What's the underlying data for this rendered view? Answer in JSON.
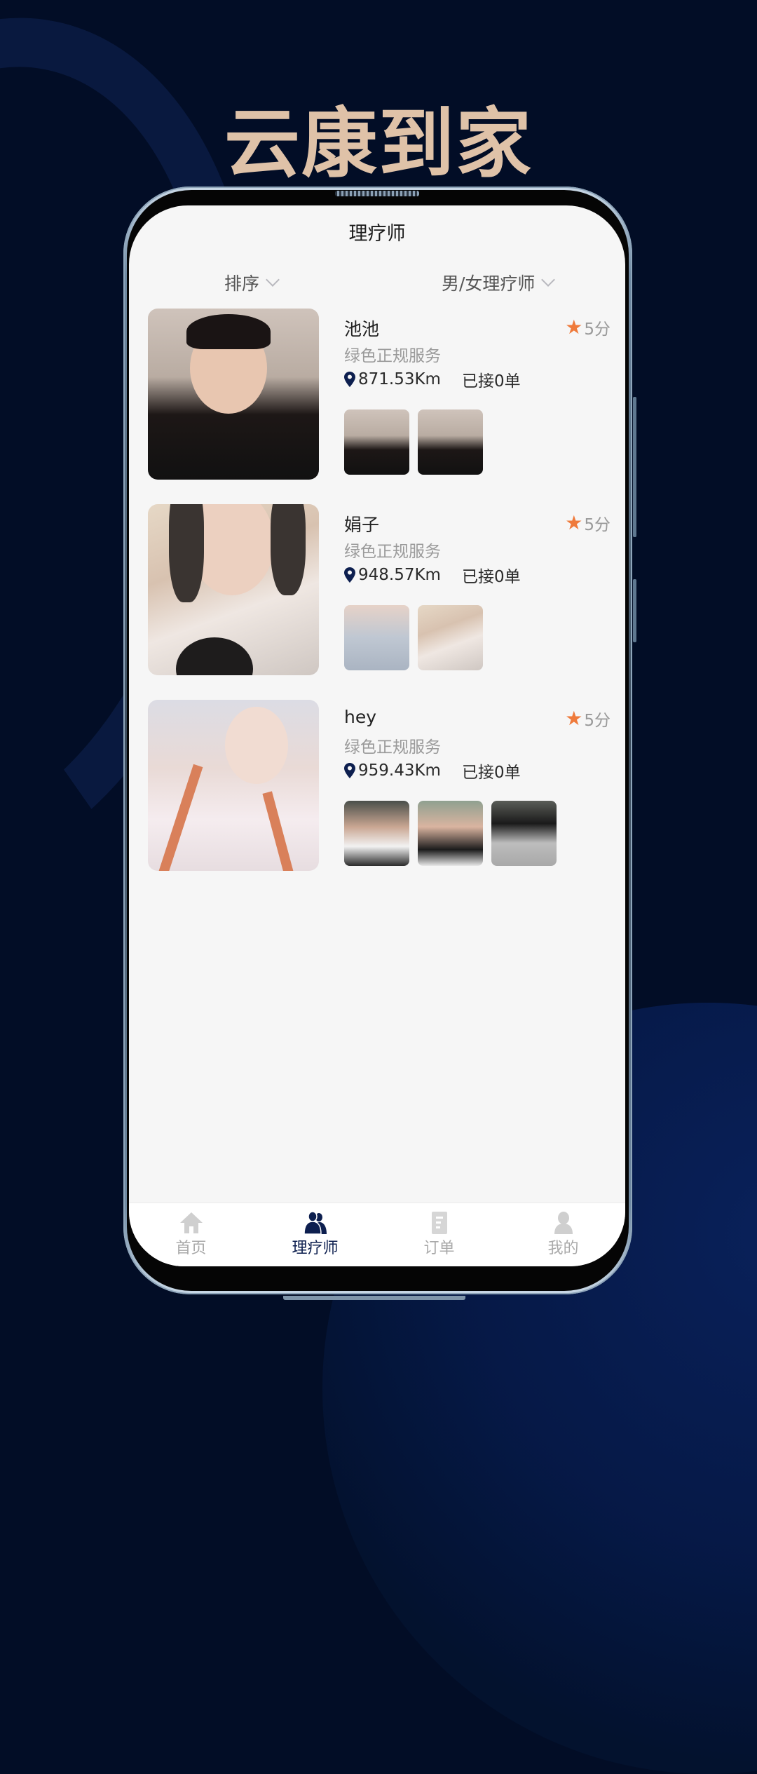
{
  "promo": {
    "title": "云康到家"
  },
  "header": {
    "title": "理疗师"
  },
  "filters": [
    {
      "label": "排序"
    },
    {
      "label": "男/女理疗师"
    }
  ],
  "therapists": [
    {
      "name": "池池",
      "rating": "5分",
      "tag": "绿色正规服务",
      "distance": "871.53Km",
      "orders": "已接0单",
      "photo_count": 2
    },
    {
      "name": "娟子",
      "rating": "5分",
      "tag": "绿色正规服务",
      "distance": "948.57Km",
      "orders": "已接0单",
      "photo_count": 2
    },
    {
      "name": "hey",
      "rating": "5分",
      "tag": "绿色正规服务",
      "distance": "959.43Km",
      "orders": "已接0单",
      "photo_count": 3
    }
  ],
  "tabbar": {
    "items": [
      {
        "label": "首页",
        "icon": "home-icon",
        "active": false
      },
      {
        "label": "理疗师",
        "icon": "users-icon",
        "active": true
      },
      {
        "label": "订单",
        "icon": "order-icon",
        "active": false
      },
      {
        "label": "我的",
        "icon": "user-icon",
        "active": false
      }
    ]
  },
  "colors": {
    "background": "#020d26",
    "title": "#dfc2a8",
    "accent": "#0d1f4f",
    "star": "#ef7a3b",
    "inactive": "#a9a9a9"
  }
}
